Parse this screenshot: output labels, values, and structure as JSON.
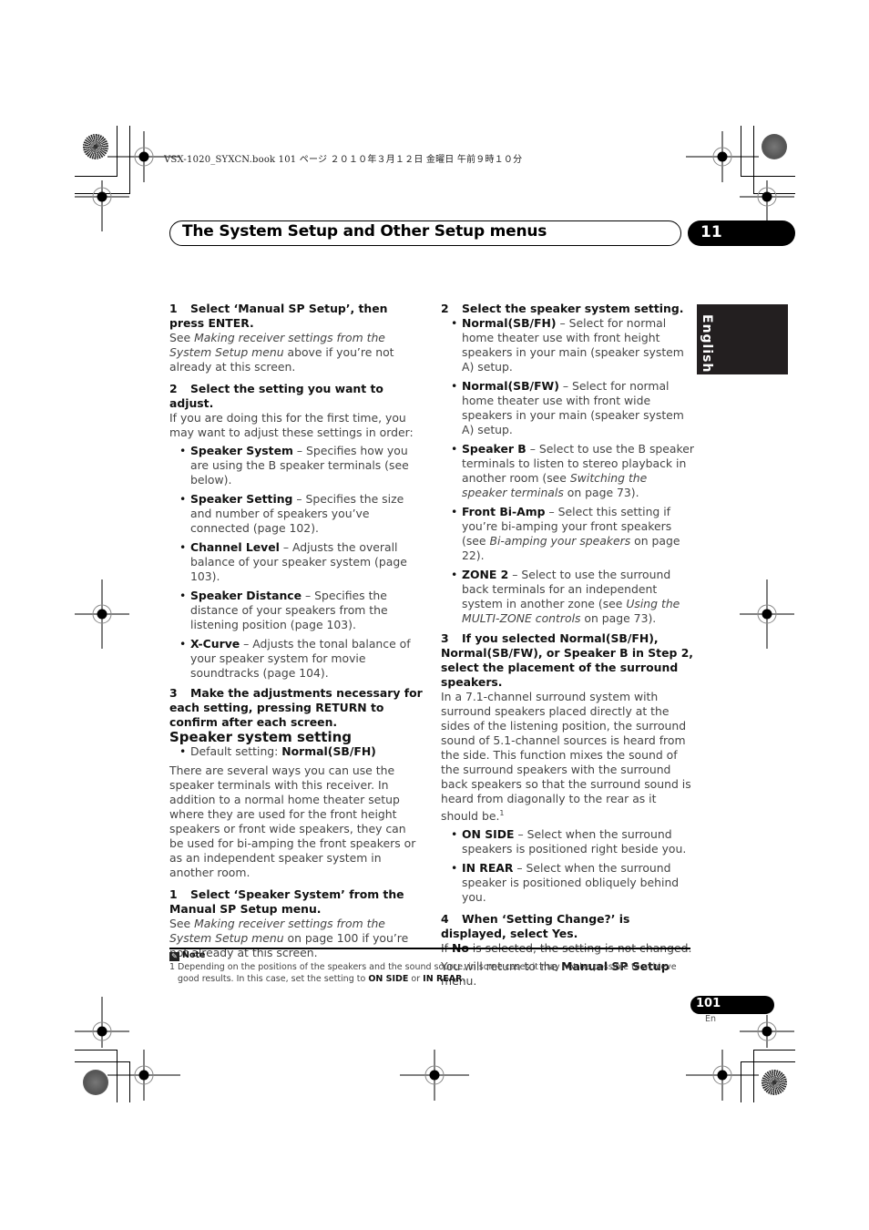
{
  "print_header": {
    "text": "VSX-1020_SYXCN.book   101 ページ   ２０１０年３月１２日   金曜日   午前９時１０分"
  },
  "chapter": {
    "title": "The System Setup and Other Setup menus",
    "number": "11"
  },
  "language_tab": "English",
  "left_column": {
    "step1": {
      "num": "1",
      "heading": "Select ‘Manual SP Setup’, then press ENTER."
    },
    "step1_body": {
      "pre": "See ",
      "link": "Making receiver settings from the System Setup menu",
      "post": " above if you’re not already at this screen."
    },
    "step2": {
      "num": "2",
      "heading": "Select the setting you want to adjust."
    },
    "step2_body": "If you are doing this for the first time, you may want to adjust these settings in order:",
    "settings": [
      {
        "term": "Speaker System",
        "desc": " – Specifies how you are using the B speaker terminals (see below)."
      },
      {
        "term": "Speaker Setting",
        "desc": " – Specifies the size and number of speakers you’ve connected (page 102)."
      },
      {
        "term": "Channel Level",
        "desc": " – Adjusts the overall balance of your speaker system (page 103)."
      },
      {
        "term": "Speaker Distance",
        "desc": " – Specifies the distance of your speakers from the listening position (page 103)."
      },
      {
        "term": "X-Curve",
        "desc": " – Adjusts the tonal balance of your speaker system for movie soundtracks (page 104)."
      }
    ],
    "step3": {
      "num": "3",
      "heading": "Make the adjustments necessary for each setting, pressing RETURN to confirm after each screen."
    },
    "section_heading": "Speaker system setting",
    "default_label": "Default setting: ",
    "default_value": "Normal(SB/FH)",
    "section_body": "There are several ways you can use the speaker terminals with this receiver. In addition to a normal home theater setup where they are used for the front height speakers or front wide speakers, they can be used for bi-amping the front speakers or as an independent speaker system in another room.",
    "sub_step1": {
      "num": "1",
      "heading": "Select ‘Speaker System’ from the Manual SP Setup menu."
    },
    "sub_step1_body": {
      "pre": "See ",
      "link": "Making receiver settings from the System Setup menu",
      "post": " on page 100 if you’re not already at this screen."
    }
  },
  "right_column": {
    "step2": {
      "num": "2",
      "heading": "Select the speaker system setting."
    },
    "options": [
      {
        "term": "Normal(SB/FH)",
        "desc": " – Select for normal home theater use with front height speakers in your main (speaker system A) setup.",
        "link": "",
        "post": ""
      },
      {
        "term": "Normal(SB/FW)",
        "desc": " – Select for normal home theater use with front wide speakers in your main (speaker system A) setup.",
        "link": "",
        "post": ""
      },
      {
        "term": "Speaker B",
        "desc": " – Select to use the B speaker terminals to listen to stereo playback in another room (see ",
        "link": "Switching the speaker terminals",
        "post": " on page 73)."
      },
      {
        "term": "Front Bi-Amp",
        "desc": " – Select this setting if you’re bi-amping your front speakers (see ",
        "link": "Bi-amping your speakers",
        "post": " on page 22)."
      },
      {
        "term": "ZONE 2",
        "desc": " – Select to use the surround back terminals for an independent system in another zone (see ",
        "link": "Using the MULTI-ZONE controls",
        "post": " on page 73)."
      }
    ],
    "step3": {
      "num": "3",
      "heading": "If you selected Normal(SB/FH), Normal(SB/FW), or Speaker B in Step 2, select the placement of the surround speakers."
    },
    "step3_body": "In a 7.1-channel surround system with surround speakers placed directly at the sides of the listening position, the surround sound of 5.1-channel sources is heard from the side. This function mixes the sound of the surround speakers with the surround back speakers so that the surround sound is heard from diagonally to the rear as it should be.",
    "footnote_ref": "1",
    "placements": [
      {
        "term": "ON SIDE",
        "desc": " – Select when the surround speakers is positioned right beside you."
      },
      {
        "term": "IN REAR",
        "desc": " – Select when the surround speaker is positioned obliquely behind you."
      }
    ],
    "step4": {
      "num": "4",
      "heading": "When ‘Setting Change?’ is displayed, select Yes."
    },
    "step4_line1": {
      "pre": "If ",
      "bold": "No",
      "post": " is selected, the setting is not changed."
    },
    "step4_line2": {
      "pre": "You will return to the ",
      "bold": "Manual SP Setup",
      "post": " menu."
    }
  },
  "note": {
    "heading": "Note",
    "icon": "pencil-icon",
    "number": "1",
    "text_pre": "Depending on the positions of the speakers and the sound source, in some cases it may not be possible to achieve good results. In this case, set the setting to ",
    "bold1": "ON SIDE",
    "mid": " or ",
    "bold2": "IN REAR",
    "end": "."
  },
  "footer": {
    "page_number": "101",
    "language_code": "En"
  }
}
